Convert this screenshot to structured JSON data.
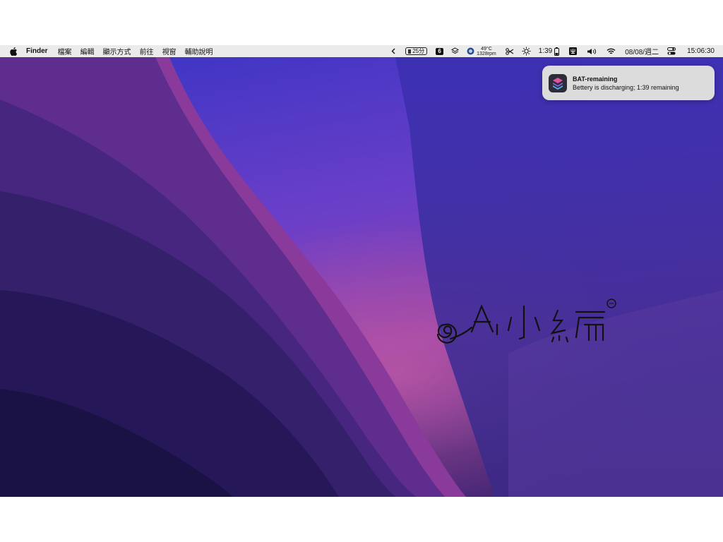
{
  "menubar": {
    "app_name": "Finder",
    "menus": [
      "檔案",
      "編輯",
      "顯示方式",
      "前往",
      "視窗",
      "輔助說明"
    ],
    "timer_label": "25分",
    "badge_number": "6",
    "temperature": "49°C",
    "fan_speed": "1328rpm",
    "battery_time": "1:39",
    "date": "08/08/週二",
    "time": "15:06:30"
  },
  "notification": {
    "title": "BAT-remaining",
    "body": "Bettery is discharging; 1:39 remaining"
  },
  "colors": {
    "menubar_bg": "#ebebeb",
    "notification_bg": "#dcdcdc",
    "wallpaper_top": "#3b36b8",
    "wallpaper_bottom": "#1a1340"
  }
}
